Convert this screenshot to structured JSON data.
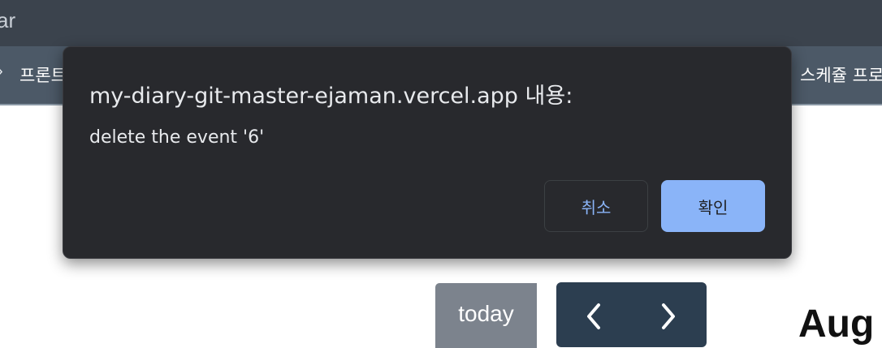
{
  "toolbar": {
    "text": "ar"
  },
  "navbar": {
    "left_item": "프론트",
    "right_item": "스케쥴 프로"
  },
  "calendar": {
    "today_label": "today",
    "month_title_partial": "Aug"
  },
  "dialog": {
    "title": "my-diary-git-master-ejaman.vercel.app 내용:",
    "message": "delete the event '6'",
    "cancel_label": "취소",
    "ok_label": "확인"
  },
  "colors": {
    "toolbar_bg": "#3b434d",
    "navbar_bg": "#4c5967",
    "dialog_bg": "#28292d",
    "accent": "#8ab4f8",
    "calendar_nav_bg": "#2c3e50",
    "today_btn_bg": "#7c838d"
  },
  "icons": {
    "prev": "chevron-left-icon",
    "next": "chevron-right-icon"
  }
}
